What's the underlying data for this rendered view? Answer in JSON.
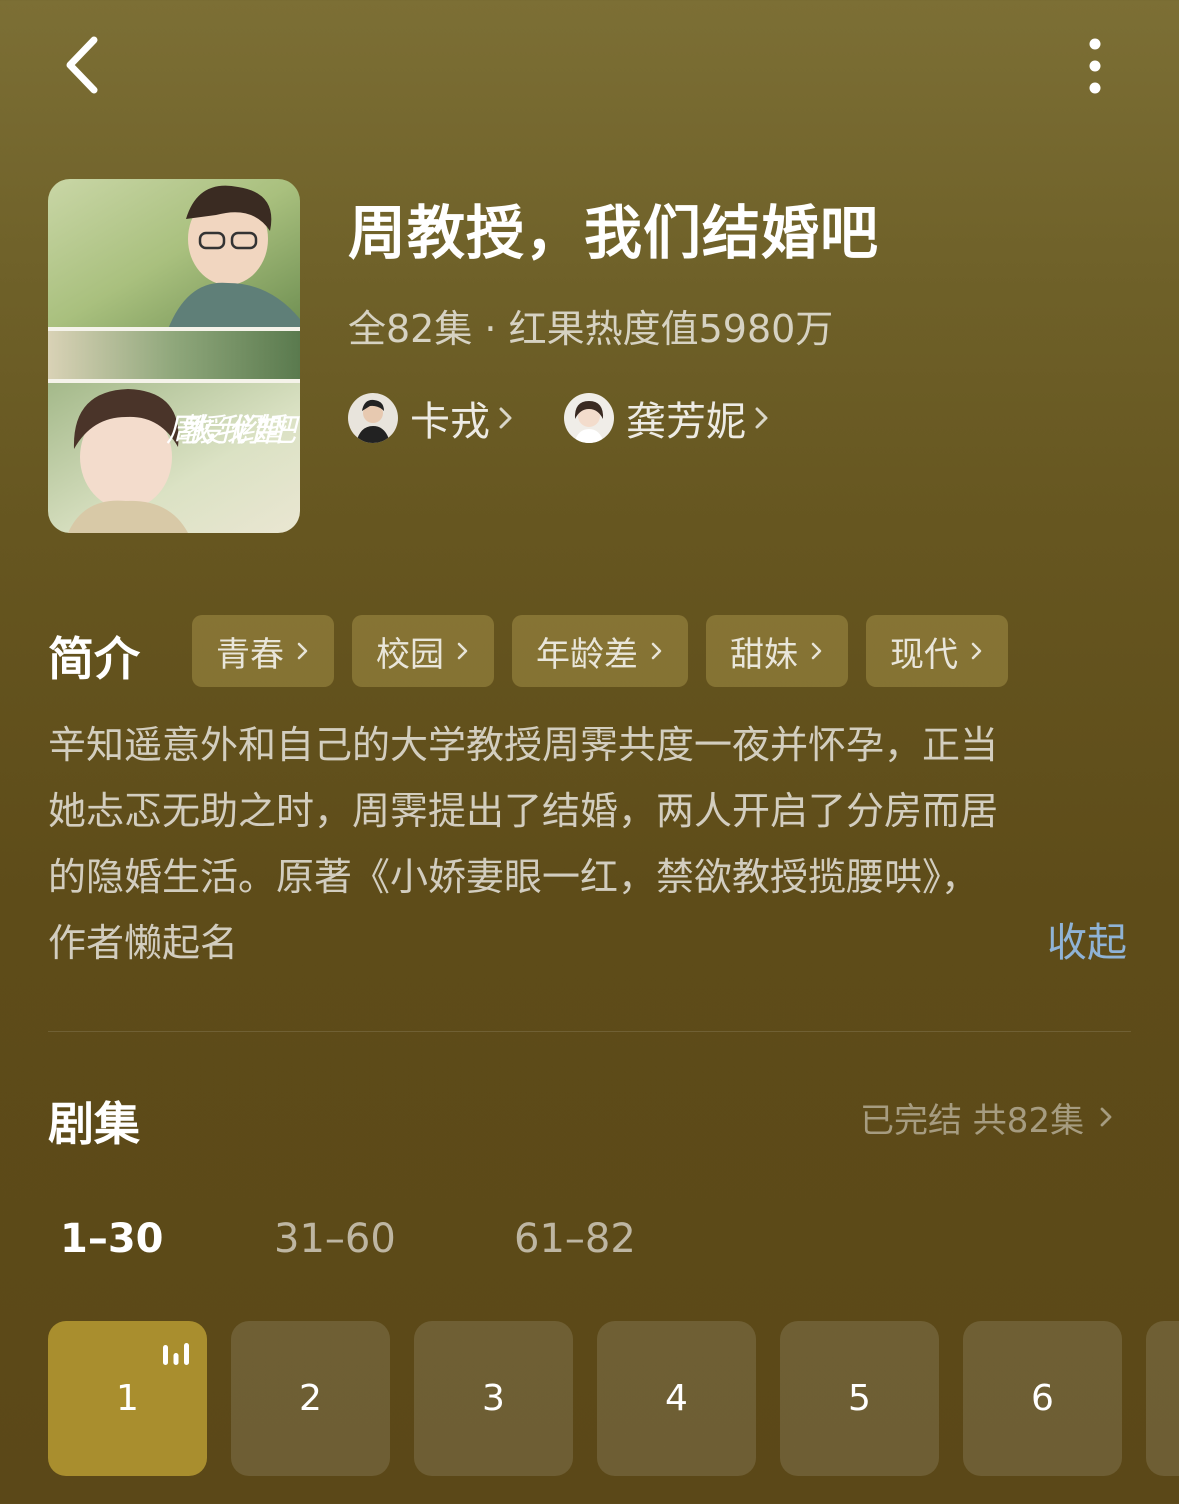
{
  "header": {
    "back_icon": "chevron-left-icon",
    "more_icon": "more-vertical-icon"
  },
  "drama": {
    "title": "周教授，我们结婚吧",
    "meta": "全82集 · 红果热度值5980万",
    "actors": [
      {
        "name": "卡戎"
      },
      {
        "name": "龚芳妮"
      }
    ]
  },
  "poster": {
    "logo_text": "周教授，我们结婚吧"
  },
  "intro": {
    "heading": "简介",
    "tags": [
      "青春",
      "校园",
      "年龄差",
      "甜妹",
      "现代"
    ],
    "lines": [
      "辛知遥意外和自己的大学教授周霁共度一夜并怀孕，正当",
      "她忐忑无助之时，周霁提出了结婚，两人开启了分房而居",
      "的隐婚生活。原著《小娇妻眼一红，禁欲教授揽腰哄》，",
      "作者懒起名"
    ],
    "collapse_label": "收起"
  },
  "episodes": {
    "heading": "剧集",
    "status": "已完结 共82集",
    "ranges": [
      "1–30",
      "31–60",
      "61–82"
    ],
    "active_range": 0,
    "items": [
      "1",
      "2",
      "3",
      "4",
      "5",
      "6"
    ],
    "active_item": 0
  },
  "colors": {
    "accent_gold": "#a98e2e",
    "link_blue": "#8fb3d6",
    "background": "#5e4c19"
  }
}
